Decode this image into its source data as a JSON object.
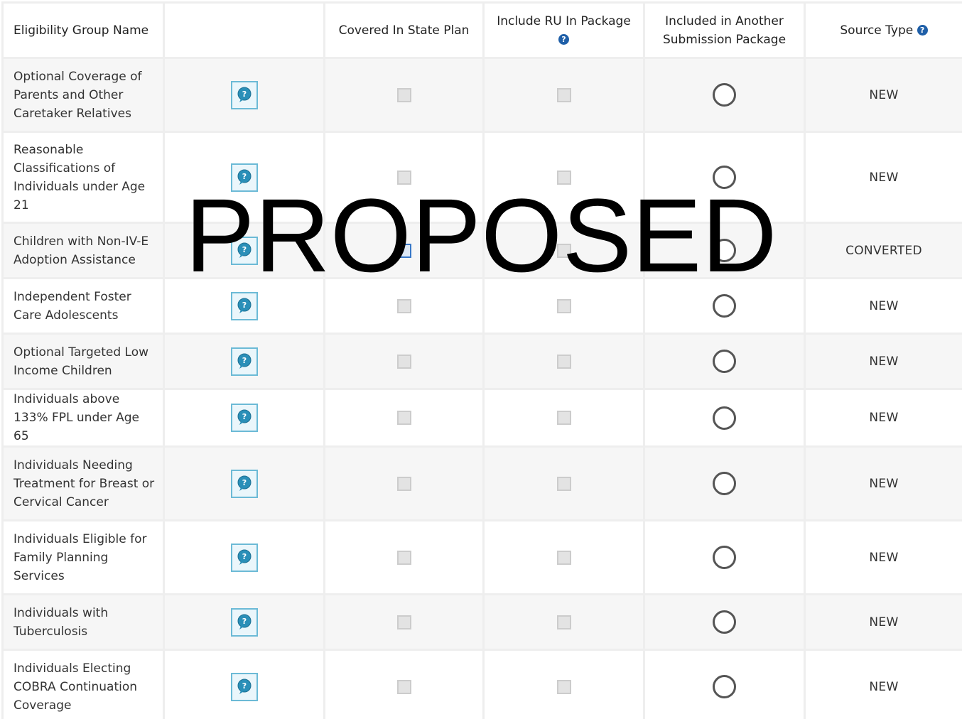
{
  "table": {
    "headers": {
      "group_name": "Eligibility Group Name",
      "blank": "",
      "covered": "Covered In State Plan",
      "include_ru": "Include RU In Package",
      "another_pkg_line1": "Included in Another",
      "another_pkg_line2": "Submission Package",
      "source_type": "Source Type"
    },
    "help_icon": "question-circle-icon",
    "rows": [
      {
        "name": "Optional Coverage of Parents and Other Caretaker Relatives",
        "covered": false,
        "include_ru": false,
        "another_pkg": false,
        "source_type": "NEW"
      },
      {
        "name": "Reasonable Classifications of Individuals under Age 21",
        "covered": false,
        "include_ru": false,
        "another_pkg": false,
        "source_type": "NEW"
      },
      {
        "name": "Children with Non-IV-E Adoption Assistance",
        "covered": true,
        "include_ru": false,
        "another_pkg": false,
        "source_type": "CONVERTED"
      },
      {
        "name": "Independent Foster Care Adolescents",
        "covered": false,
        "include_ru": false,
        "another_pkg": false,
        "source_type": "NEW"
      },
      {
        "name": "Optional Targeted Low Income Children",
        "covered": false,
        "include_ru": false,
        "another_pkg": false,
        "source_type": "NEW"
      },
      {
        "name": "Individuals above 133% FPL under Age 65",
        "covered": false,
        "include_ru": false,
        "another_pkg": false,
        "source_type": "NEW"
      },
      {
        "name": "Individuals  Needing Treatment for Breast or Cervical Cancer",
        "covered": false,
        "include_ru": false,
        "another_pkg": false,
        "source_type": "NEW"
      },
      {
        "name": "Individuals Eligible for Family Planning Services",
        "covered": false,
        "include_ru": false,
        "another_pkg": false,
        "source_type": "NEW"
      },
      {
        "name": "Individuals with Tuberculosis",
        "covered": false,
        "include_ru": false,
        "another_pkg": false,
        "source_type": "NEW"
      },
      {
        "name": "Individuals Electing COBRA Continuation Coverage",
        "covered": false,
        "include_ru": false,
        "another_pkg": false,
        "source_type": "NEW"
      }
    ]
  },
  "watermark": "PROPOSED",
  "colors": {
    "help_badge": "#1f5fa8",
    "bubble_border": "#6cbad6",
    "checked_border": "#3878c8",
    "radio_border": "#555555"
  }
}
